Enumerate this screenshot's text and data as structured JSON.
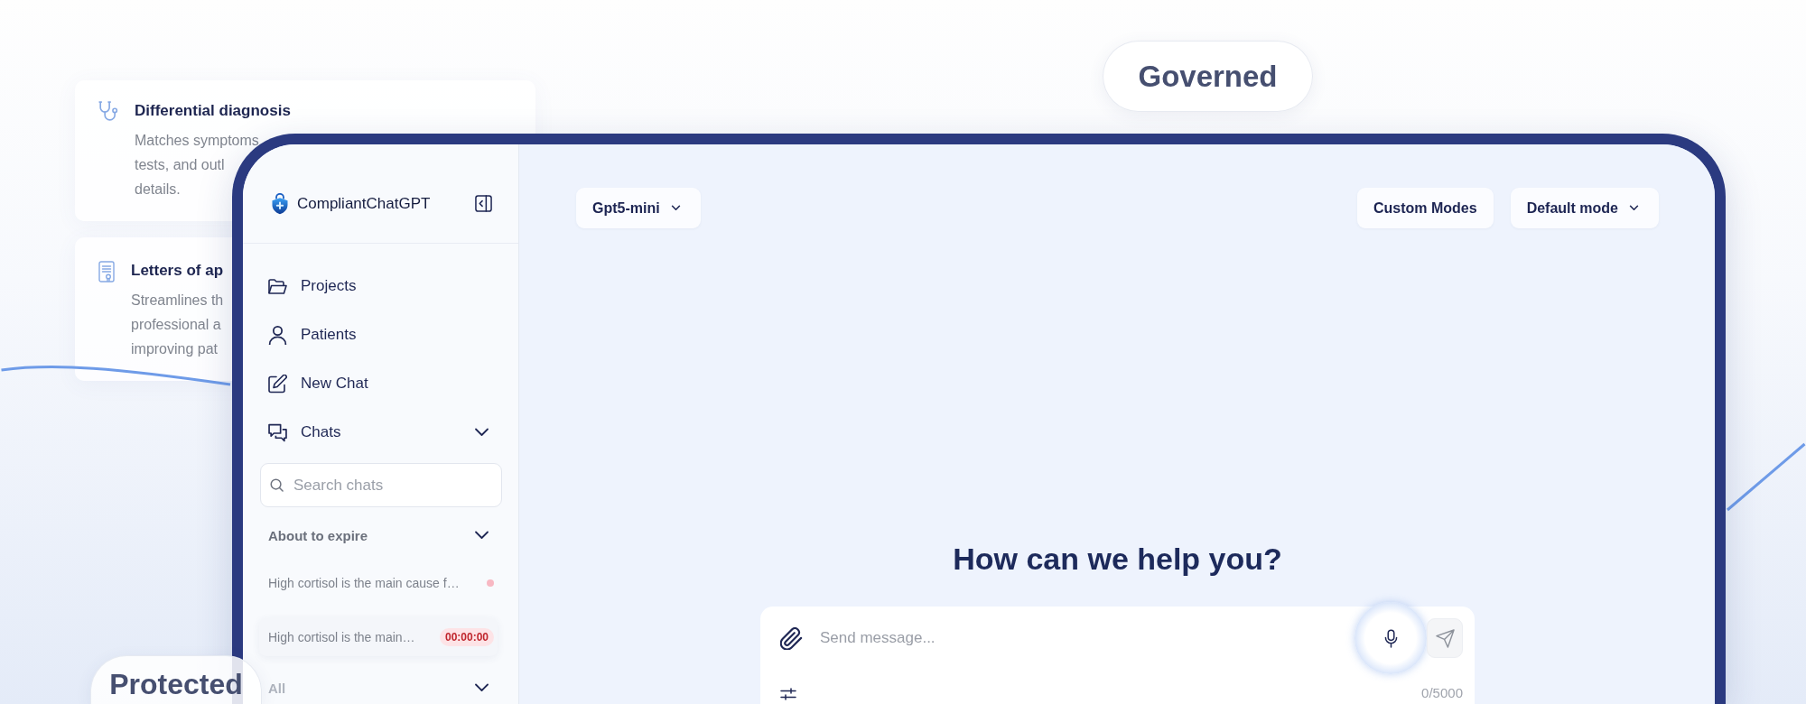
{
  "feature_cards": [
    {
      "kind": "stethoscope",
      "title": "Differential diagnosis",
      "lines": [
        "Matches symptoms",
        "tests, and outl",
        "details."
      ]
    },
    {
      "kind": "letter",
      "title": "Letters of ap",
      "lines": [
        "Streamlines th",
        "professional a",
        "improving pat"
      ]
    }
  ],
  "pills": [
    {
      "label": "Governed"
    },
    {
      "label": "Protected"
    }
  ],
  "sidebar": {
    "brand": "CompliantChatGPT",
    "nav": [
      {
        "label": "Projects",
        "kind": "folder"
      },
      {
        "label": "Patients",
        "kind": "user"
      },
      {
        "label": "New Chat",
        "kind": "edit"
      }
    ],
    "chats_group": {
      "label": "Chats",
      "expanded": true
    },
    "search": {
      "placeholder": "Search chats"
    },
    "sections": [
      {
        "title": "About to expire",
        "expanded": true,
        "items": [
          {
            "text": "High cortisol is the main cause f…",
            "kind": "dot",
            "selected": false
          },
          {
            "text": "High cortisol is the main…",
            "kind": "timer",
            "timer": "00:00:00",
            "selected": true
          }
        ]
      },
      {
        "title": "All",
        "expanded": true
      }
    ]
  },
  "toolbar": {
    "model": "Gpt5-mini",
    "buttons": [
      {
        "label": "Custom Modes",
        "kind": "button"
      },
      {
        "label": "Default mode",
        "kind": "dropdown"
      }
    ]
  },
  "heading": "How can we help you?",
  "composer": {
    "placeholder": "Send message...",
    "mic_active": true,
    "send_disabled": true,
    "counter": "0/5000"
  }
}
